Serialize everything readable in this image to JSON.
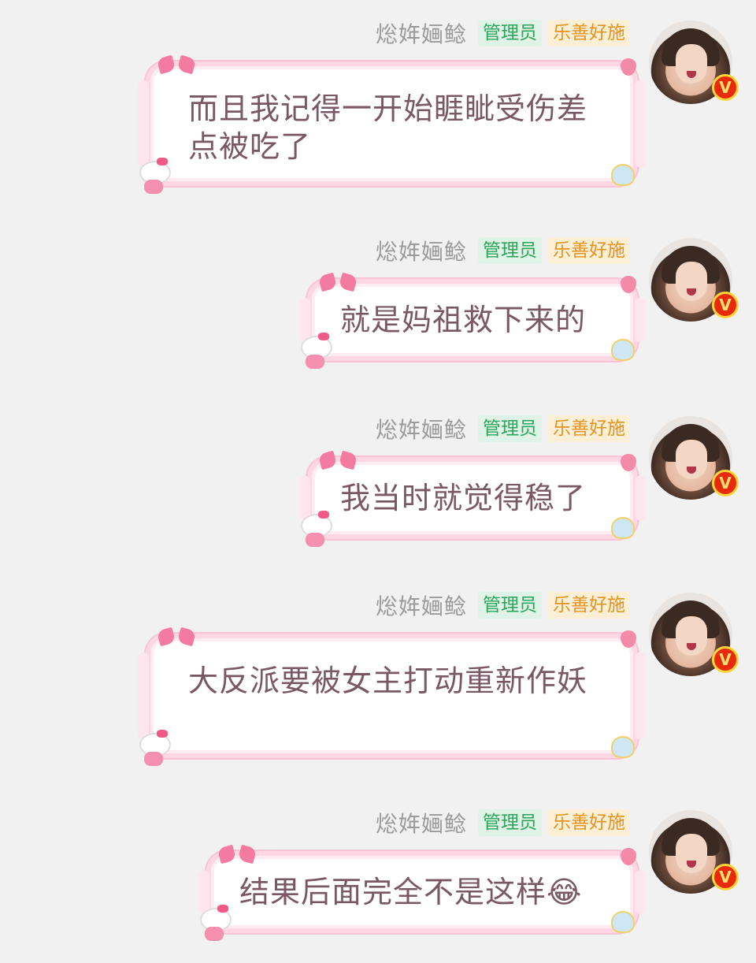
{
  "sender": {
    "nickname": "焧姩婳鲶",
    "badge_admin": "管理员",
    "badge_title": "乐善好施",
    "verified_icon": "V"
  },
  "messages": [
    {
      "text": "而且我记得一开始睚眦受伤差点被吃了"
    },
    {
      "text": "就是妈祖救下来的"
    },
    {
      "text": "我当时就觉得稳了"
    },
    {
      "text": "大反派要被女主打动重新作妖"
    },
    {
      "text": "结果后面完全不是这样😂"
    }
  ],
  "colors": {
    "background": "#f1f1f1",
    "bubble_border": "#ffd6e4",
    "text": "#7a5764",
    "admin_badge": "#2fa45b",
    "title_badge": "#e6921f"
  }
}
